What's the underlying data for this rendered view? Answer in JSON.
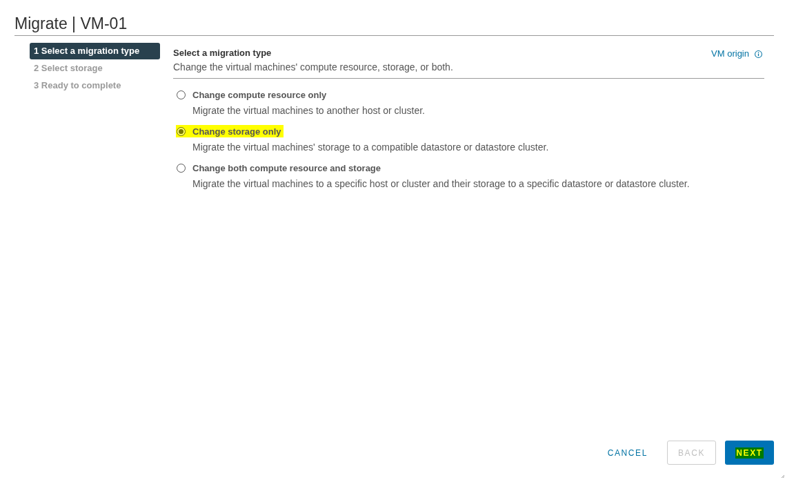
{
  "window": {
    "title": "Migrate | VM-01"
  },
  "steps": [
    {
      "label": "1 Select a migration type",
      "selected": true
    },
    {
      "label": "2 Select storage",
      "selected": false
    },
    {
      "label": "3 Ready to complete",
      "selected": false
    }
  ],
  "page": {
    "heading": "Select a migration type",
    "subtitle": "Change the virtual machines' compute resource, storage, or both.",
    "link": "VM origin"
  },
  "options": [
    {
      "label": "Change compute resource only",
      "description": "Migrate the virtual machines to another host or cluster.",
      "selected": false,
      "highlighted": false
    },
    {
      "label": "Change storage only",
      "description": "Migrate the virtual machines' storage to a compatible datastore or datastore cluster.",
      "selected": true,
      "highlighted": true
    },
    {
      "label": "Change both compute resource and storage",
      "description": "Migrate the virtual machines to a specific host or cluster and their storage to a specific datastore or datastore cluster.",
      "selected": false,
      "highlighted": false
    }
  ],
  "buttons": [
    {
      "label": "CANCEL",
      "kind": "link",
      "disabled": false,
      "highlighted": false
    },
    {
      "label": "BACK",
      "kind": "outline",
      "disabled": true,
      "highlighted": false
    },
    {
      "label": "NEXT",
      "kind": "primary",
      "disabled": false,
      "highlighted": true
    }
  ]
}
